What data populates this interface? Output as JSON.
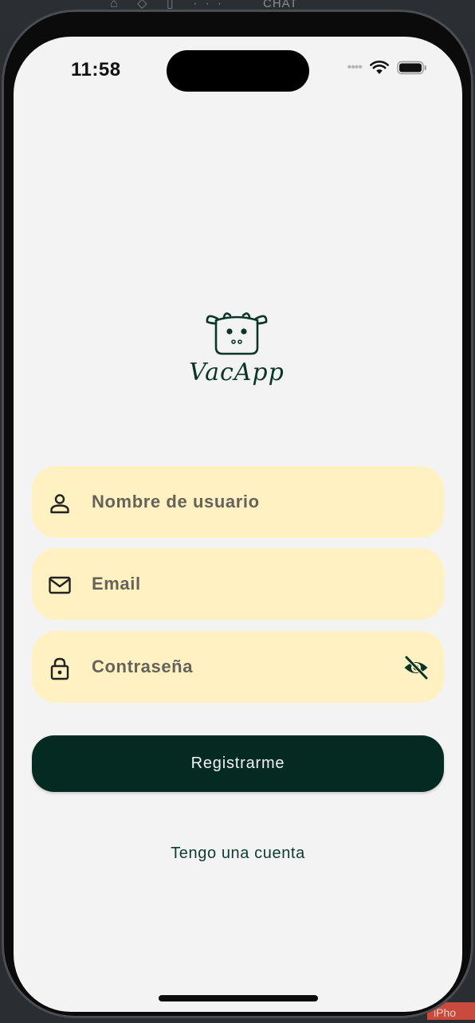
{
  "status_bar": {
    "time": "11:58"
  },
  "backdrop": {
    "top_label": "CHAT",
    "corner_label": "iPho"
  },
  "logo": {
    "name": "VacApp",
    "icon": "cow-face-icon"
  },
  "form": {
    "username": {
      "placeholder": "Nombre de usuario",
      "value": "",
      "icon": "person-icon"
    },
    "email": {
      "placeholder": "Email",
      "value": "",
      "icon": "envelope-icon"
    },
    "password": {
      "placeholder": "Contraseña",
      "value": "",
      "icon": "lock-icon",
      "toggle_icon": "eye-slash-icon"
    }
  },
  "actions": {
    "register_label": "Registrarme",
    "have_account_label": "Tengo una cuenta"
  },
  "colors": {
    "background": "#f3f3f3",
    "field_background": "#fff1c1",
    "primary": "#052a22",
    "link": "#0d3b31"
  }
}
